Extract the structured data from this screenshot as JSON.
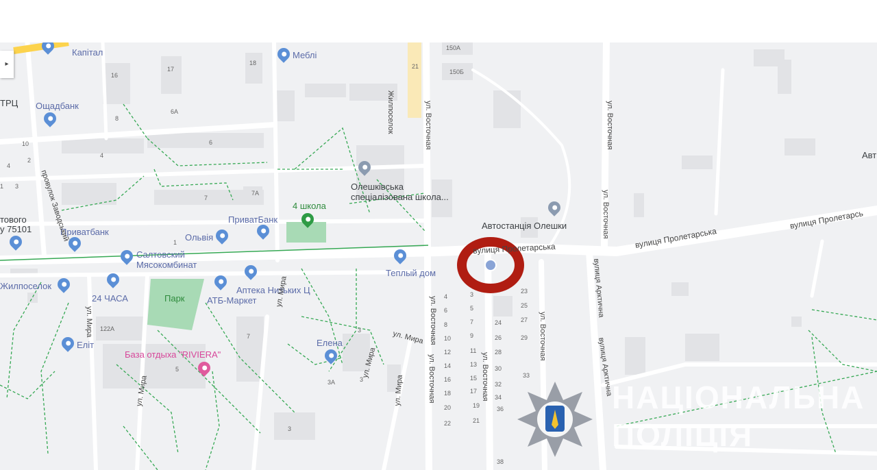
{
  "colors": {
    "map_bg": "#f0f1f3",
    "road": "#ffffff",
    "building": "#e2e3e6",
    "path_green": "#35a853",
    "park_fill": "#a8dab5",
    "poi_blue": "#5b8fd6",
    "marker_ring": "#b01d12",
    "police_star": "#8a8f99"
  },
  "streets": {
    "vostochna_top": "ул. Восточная",
    "vostochna_right": "ул. Восточная",
    "vostochna_lower": "ул. Восточная",
    "vostochna_lower2": "ул. Восточная",
    "vostochna_right2": "ул. Восточная",
    "proletarska_main": "вулиця Пролетарська",
    "proletarska_right": "вулиця Пролетарсь",
    "proletarska_marker": "вулиця Пролетарська",
    "arktychna": "вулиця Арктична",
    "arktychna_2": "вулиця Арктична",
    "zhylposelok": "Жилпоселок",
    "zavodskyi": "провулок Заводський",
    "mira_1": "ул. Мира",
    "mira_2": "ул. Мира",
    "mira_3": "ул. Мира",
    "mira_4": "ул. Мира",
    "mira_5": "ул. Мира",
    "vostochna_far": "ул. Восточная"
  },
  "places": {
    "kapital": "Капітал",
    "mebli": "Меблі",
    "oschadbank": "Ощадбанк",
    "trts": "ТРЦ",
    "avt": "Авт",
    "school_spec": "Олешківська спеціалізована школа...",
    "school_4": "4 школа",
    "privatbank_1": "ПриватБанк",
    "privatbank_2": "Приватбанк",
    "olviya": "Ольвія",
    "avtostantsiya": "Автостанція Олешки",
    "saltovskyi": "Салтовский Мясокомбинат",
    "teplyi_dim": "Теплый дом",
    "zhylposelok_shop": "Жилпоселок",
    "chasa_24": "24 ЧАСА",
    "park": "Парк",
    "apteka": "Аптека Низьких Ц",
    "atb": "АТБ-Маркет",
    "elena": "Елена",
    "elit": "Еліт",
    "riviera": "База отдыха \"RIVIERA\"",
    "post_1": "тового",
    "post_2": "у 75101"
  },
  "house_numbers": [
    "150А",
    "150Б",
    "21",
    "16",
    "17",
    "18",
    "6А",
    "8",
    "6",
    "10",
    "4",
    "2",
    "3",
    "7",
    "7А",
    "1",
    "4",
    "1",
    "3",
    "122А",
    "5",
    "3",
    "3А",
    "7",
    "3",
    "4",
    "6",
    "8",
    "10",
    "12",
    "14",
    "16",
    "18",
    "20",
    "22",
    "3",
    "5",
    "7",
    "9",
    "11",
    "13",
    "15",
    "17",
    "19",
    "21",
    "23",
    "25",
    "27",
    "29",
    "24",
    "26",
    "28",
    "30",
    "32",
    "34",
    "36",
    "33",
    "38"
  ],
  "watermark": {
    "line1": "НАЦІОНАЛЬНА",
    "line2": "ПОЛІЦІЯ"
  },
  "controls": {
    "expand_arrow": "▸"
  }
}
